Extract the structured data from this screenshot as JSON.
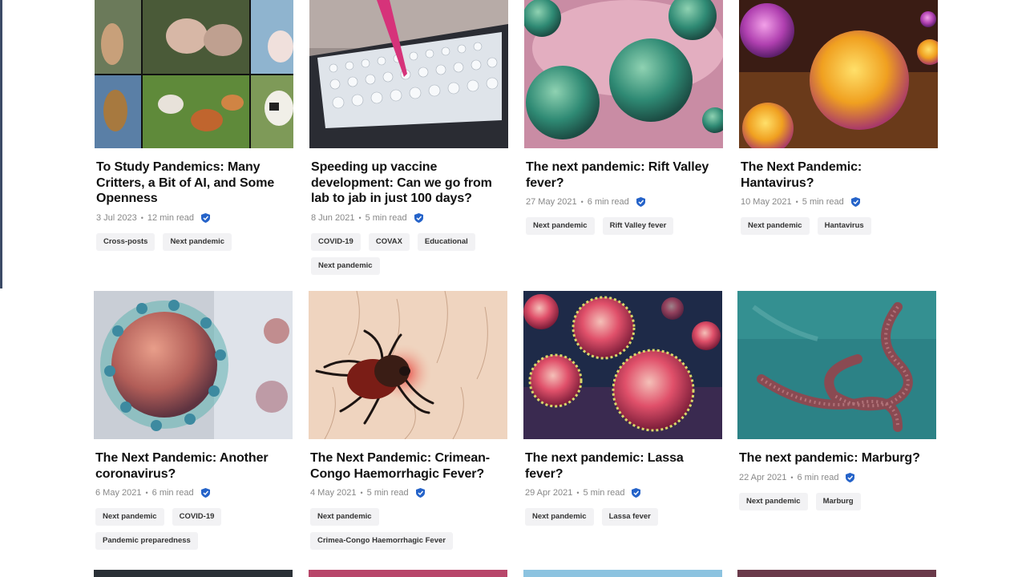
{
  "articles": [
    {
      "title": "To Study Pandemics: Many Critters, a Bit of AI, and Some Openness",
      "date": "3 Jul 2023",
      "read": "12 min read",
      "tags": [
        "Cross-posts",
        "Next pandemic"
      ],
      "image": "animals-collage"
    },
    {
      "title": "Speeding up vaccine development: Can we go from lab to jab in just 100 days?",
      "date": "8 Jun 2021",
      "read": "5 min read",
      "tags": [
        "COVID-19",
        "COVAX",
        "Educational",
        "Next pandemic"
      ],
      "image": "lab-pipette-plate"
    },
    {
      "title": "The next pandemic: Rift Valley fever?",
      "date": "27 May 2021",
      "read": "6 min read",
      "tags": [
        "Next pandemic",
        "Rift Valley fever"
      ],
      "image": "green-virus-particles"
    },
    {
      "title": "The Next Pandemic: Hantavirus?",
      "date": "10 May 2021",
      "read": "5 min read",
      "tags": [
        "Next pandemic",
        "Hantavirus"
      ],
      "image": "orange-virus-particles"
    },
    {
      "title": "The Next Pandemic: Another coronavirus?",
      "date": "6 May 2021",
      "read": "6 min read",
      "tags": [
        "Next pandemic",
        "COVID-19",
        "Pandemic preparedness"
      ],
      "image": "coronavirus"
    },
    {
      "title": "The Next Pandemic: Crimean-Congo Haemorrhagic Fever?",
      "date": "4 May 2021",
      "read": "5 min read",
      "tags": [
        "Next pandemic",
        "Crimea-Congo Haemorrhagic Fever"
      ],
      "image": "tick-on-skin"
    },
    {
      "title": "The next pandemic: Lassa fever?",
      "date": "29 Apr 2021",
      "read": "5 min read",
      "tags": [
        "Next pandemic",
        "Lassa fever"
      ],
      "image": "red-virus-particles"
    },
    {
      "title": "The next pandemic: Marburg?",
      "date": "22 Apr 2021",
      "read": "6 min read",
      "tags": [
        "Next pandemic",
        "Marburg"
      ],
      "image": "filovirus"
    }
  ],
  "dot": "•",
  "verified_color": "#2563c9",
  "tag_bg": "#f2f2f4"
}
